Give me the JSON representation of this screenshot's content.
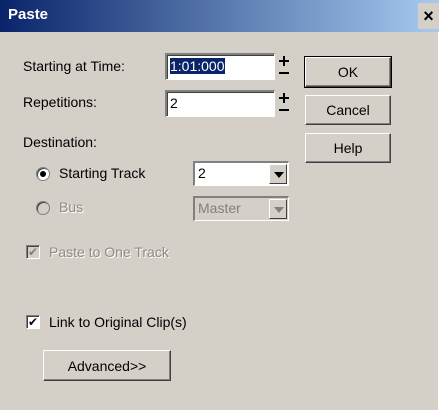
{
  "window": {
    "title": "Paste",
    "close_glyph": "×"
  },
  "starting_time": {
    "label": "Starting at Time:",
    "value": "1:01:000"
  },
  "repetitions": {
    "label": "Repetitions:",
    "value": "2"
  },
  "destination": {
    "label": "Destination:",
    "starting_track": {
      "label": "Starting Track",
      "selected": true,
      "value": "2"
    },
    "bus": {
      "label": "Bus",
      "selected": false,
      "enabled": false,
      "value": "Master"
    }
  },
  "paste_to_one_track": {
    "label": "Paste to One Track",
    "checked": true,
    "enabled": false
  },
  "link_to_original": {
    "label": "Link to Original Clip(s)",
    "checked": true
  },
  "buttons": {
    "ok": "OK",
    "cancel": "Cancel",
    "help": "Help",
    "advanced": "Advanced>>"
  },
  "check_glyph": "✔",
  "colors": {
    "title_bar_start": "#0a246a",
    "title_bar_end": "#a6caf0",
    "dialog_bg": "#d4d0c8",
    "disabled_text": "#8e8b83"
  }
}
